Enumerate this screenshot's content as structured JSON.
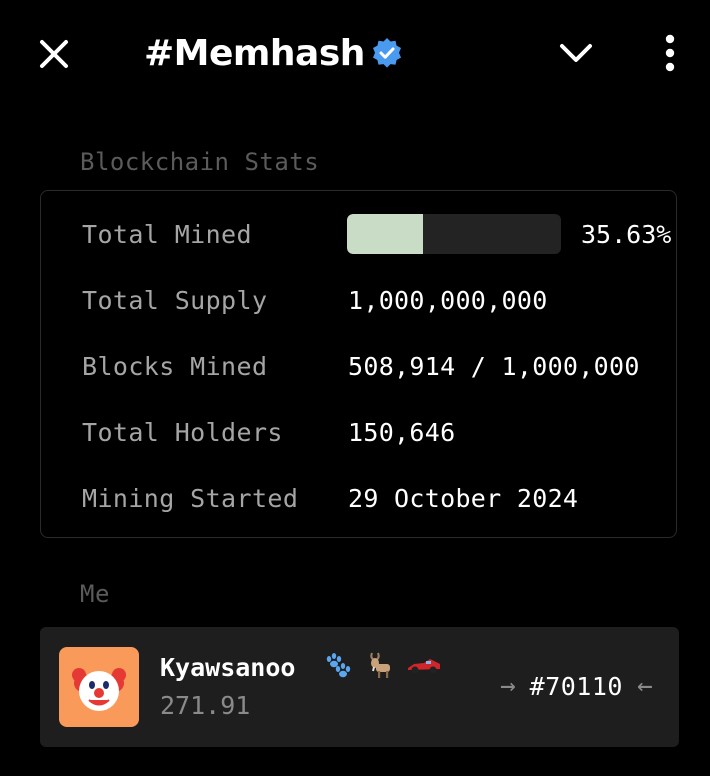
{
  "header": {
    "title": "#Memhash",
    "close_icon": "close-icon",
    "verified_icon": "verified-badge-icon",
    "collapse_icon": "chevron-down-icon",
    "menu_icon": "more-vertical-icon"
  },
  "stats": {
    "section_title": "Blockchain Stats",
    "total_mined": {
      "label": "Total Mined",
      "percent_text": "35.63%",
      "fraction": 0.3563,
      "fill_color": "#c9dcc6"
    },
    "total_supply": {
      "label": "Total Supply",
      "value": "1,000,000,000"
    },
    "blocks_mined": {
      "label": "Blocks Mined",
      "value": "508,914 / 1,000,000"
    },
    "total_holders": {
      "label": "Total Holders",
      "value": "150,646"
    },
    "mining_started": {
      "label": "Mining Started",
      "value": "29 October 2024"
    }
  },
  "me": {
    "section_title": "Me",
    "avatar_icon": "clown-face-icon",
    "avatar_bg": "#f99a5a",
    "username": "Kyawsanoo",
    "badges": [
      "paw-prints-icon",
      "goat-icon",
      "race-car-icon"
    ],
    "balance": "271.91",
    "rank": "#70110",
    "arrow_left": "→",
    "arrow_right": "←"
  },
  "colors": {
    "background": "#000000",
    "card_bg": "#1e1e1e",
    "muted_text": "#5b5b5b",
    "label_text": "#a5a5a5",
    "verified_blue": "#4a9af0"
  }
}
